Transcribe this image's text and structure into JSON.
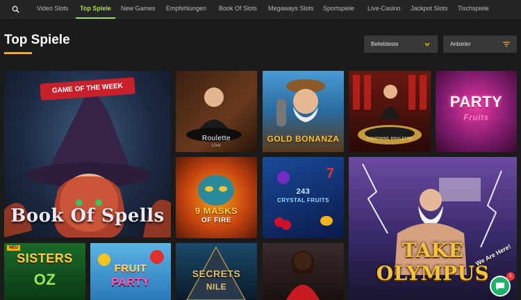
{
  "nav": {
    "items": [
      {
        "label": "Video Slots",
        "active": false
      },
      {
        "label": "Top Spiele",
        "active": true
      },
      {
        "label": "New Games",
        "active": false
      },
      {
        "label": "Empfehlungen",
        "active": false
      },
      {
        "label": "Book Of Slots",
        "active": false
      },
      {
        "label": "Megaways Slots",
        "active": false
      },
      {
        "label": "Sportspiele",
        "active": false
      },
      {
        "label": "Live-Casino",
        "active": false
      },
      {
        "label": "Jackpot Slots",
        "active": false
      },
      {
        "label": "Tischspiele",
        "active": false
      }
    ],
    "search_icon": "search-icon"
  },
  "page": {
    "title": "Top Spiele",
    "accent_color": "#f2b400"
  },
  "filters": {
    "sort_label": "Beliebteste",
    "provider_label": "Anbieter"
  },
  "games": [
    {
      "id": "book-of-spells",
      "banner": "GAME OF THE WEEK",
      "caption": "Book Of Spells"
    },
    {
      "id": "roulette",
      "caption": "Roulette",
      "sub": "Live"
    },
    {
      "id": "gold-bonanza",
      "caption": "GOLD BONANZA"
    },
    {
      "id": "lightning-roulette",
      "caption": "LIGHTNING ROULETTE"
    },
    {
      "id": "party-fruits",
      "caption": "PARTY",
      "sub": "Fruits"
    },
    {
      "id": "9-masks-of-fire",
      "caption": "9 MASKS",
      "sub": "OF FIRE"
    },
    {
      "id": "243-crystal-fruits",
      "caption": "243",
      "sub": "CRYSTAL FRUITS"
    },
    {
      "id": "take-olympus",
      "caption": "TAKE OLYMPUS"
    },
    {
      "id": "sisters-of-oz",
      "badge": "NEU",
      "caption": "SISTERS",
      "sub": "OZ"
    },
    {
      "id": "fruit-party",
      "caption": "FRUIT",
      "sub": "PARTY"
    },
    {
      "id": "secrets-of-the-nile",
      "caption": "SECRETS",
      "sub": "NILE"
    },
    {
      "id": "live-dealer",
      "caption": ""
    }
  ],
  "chat": {
    "label": "We Are Here!",
    "count": "1",
    "icon": "chat-icon"
  }
}
